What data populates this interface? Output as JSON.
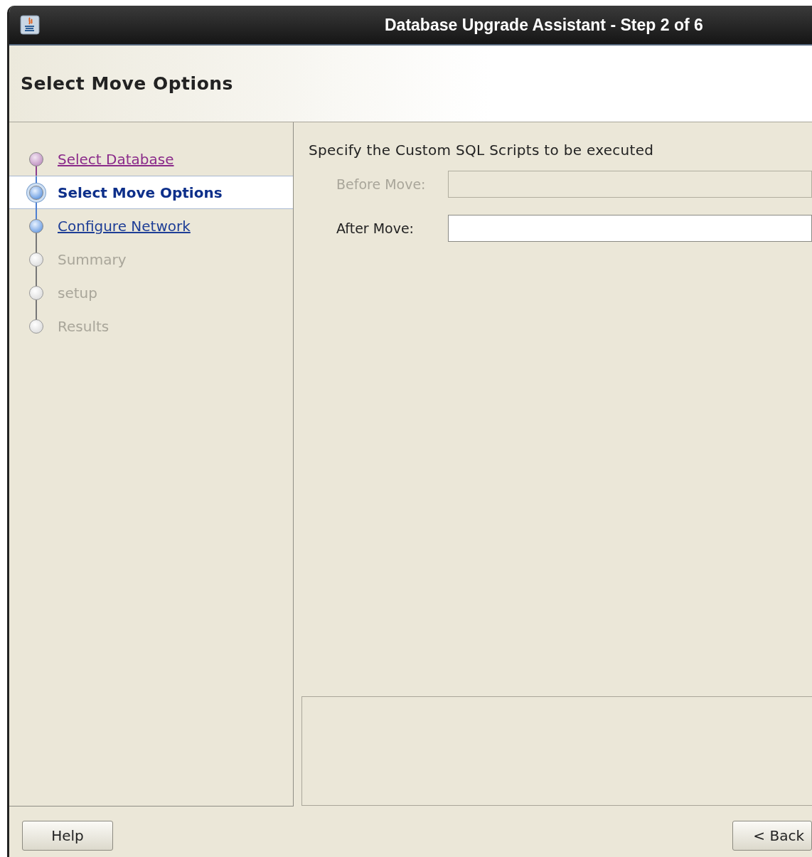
{
  "window": {
    "title": "Database Upgrade Assistant - Step 2 of 6"
  },
  "header": {
    "title": "Select Move Options"
  },
  "steps": [
    {
      "label": "Select Database",
      "kind": "visited",
      "selected": false
    },
    {
      "label": "Select Move Options",
      "kind": "current",
      "selected": true
    },
    {
      "label": "Configure Network",
      "kind": "next",
      "selected": false
    },
    {
      "label": "Summary",
      "kind": "pending",
      "selected": false
    },
    {
      "label": "setup",
      "kind": "pending",
      "selected": false
    },
    {
      "label": "Results",
      "kind": "pending",
      "selected": false
    }
  ],
  "content": {
    "instruction": "Specify the Custom SQL Scripts to be executed",
    "fields": [
      {
        "label": "Before Move:",
        "disabled": true
      },
      {
        "label": "After Move:",
        "disabled": false
      }
    ]
  },
  "buttons": {
    "help": "Help",
    "back": "< Back"
  }
}
